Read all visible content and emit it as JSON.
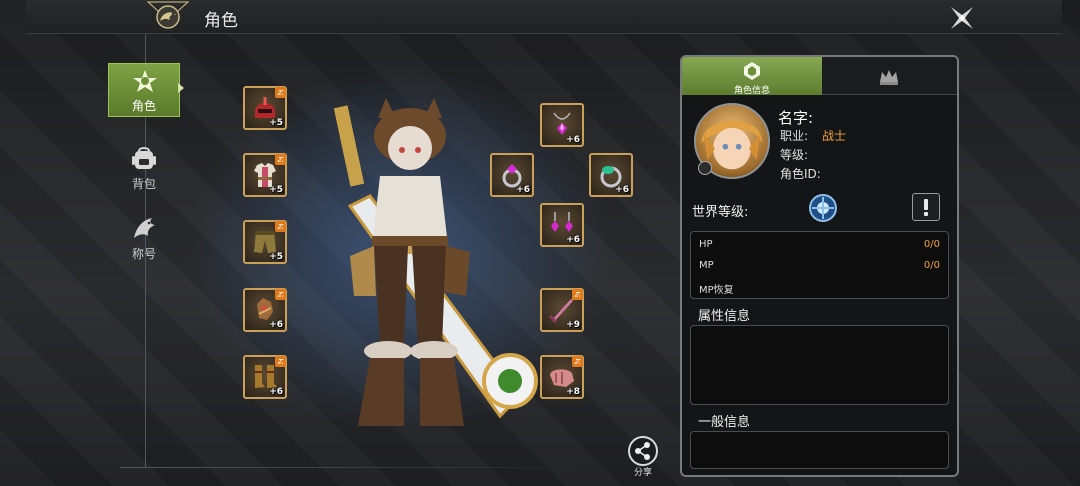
{
  "header": {
    "title": "角色",
    "emblem_icon": "dragon-emblem-icon",
    "close_icon": "close-x-icon"
  },
  "nav": {
    "items": [
      {
        "label": "角色",
        "icon": "character-emblem-icon",
        "active": true
      },
      {
        "label": "背包",
        "icon": "backpack-icon",
        "active": false
      },
      {
        "label": "称号",
        "icon": "dragon-title-icon",
        "active": false
      }
    ]
  },
  "equipment": {
    "left": [
      {
        "slot": "helmet",
        "level": "+5"
      },
      {
        "slot": "armor",
        "level": "+5"
      },
      {
        "slot": "pants",
        "level": "+5"
      },
      {
        "slot": "gloves",
        "level": "+6"
      },
      {
        "slot": "boots",
        "level": "+6"
      }
    ],
    "right": [
      {
        "slot": "necklace",
        "level": "+6"
      },
      {
        "slot": "ring-1",
        "level": "+6"
      },
      {
        "slot": "ring-2",
        "level": "+6"
      },
      {
        "slot": "earrings",
        "level": "+6"
      },
      {
        "slot": "main-weapon",
        "level": "+9"
      },
      {
        "slot": "sub-weapon",
        "level": "+8"
      }
    ]
  },
  "share": {
    "label": "分享",
    "icon": "share-icon"
  },
  "panel": {
    "tabs": [
      {
        "label": "角色信息",
        "icon": "character-info-icon",
        "active": true
      },
      {
        "label": "",
        "icon": "crown-icon",
        "active": false
      }
    ],
    "profile": {
      "name_label": "名字:",
      "job_label": "职业:",
      "job_value": "战士",
      "level_label": "等级:",
      "id_label": "角色ID:"
    },
    "world_level": {
      "label": "世界等级:",
      "icon": "world-level-icon",
      "alert_icon": "exclamation-icon"
    },
    "stats": [
      {
        "name": "HP",
        "value": "0/0"
      },
      {
        "name": "MP",
        "value": "0/0"
      },
      {
        "name": "MP恢复",
        "value": ""
      }
    ],
    "sections": {
      "attributes_title": "属性信息",
      "general_title": "一般信息"
    }
  },
  "colors": {
    "accent_green": "#7ea246",
    "value_orange": "#f2a23c",
    "slot_border": "#c9a15a"
  }
}
